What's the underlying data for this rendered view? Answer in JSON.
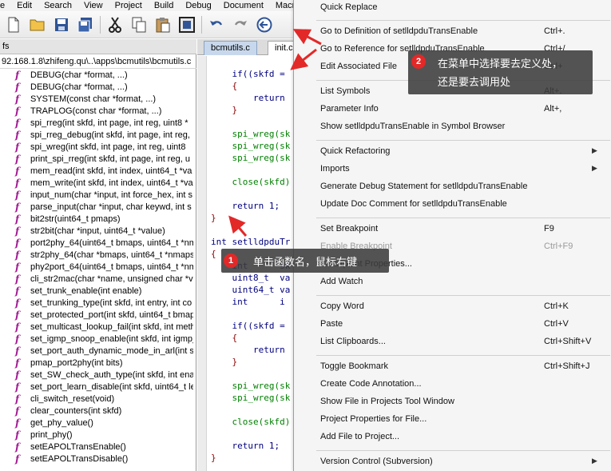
{
  "menubar": [
    "e",
    "Edit",
    "Search",
    "View",
    "Project",
    "Build",
    "Debug",
    "Document",
    "Macr"
  ],
  "toolbar_icons": [
    "new-file-icon",
    "open-folder-icon",
    "save-icon",
    "save-all-icon",
    "cut-icon",
    "copy-icon",
    "paste-icon",
    "frame-icon",
    "undo-icon",
    "redo-icon",
    "back-icon"
  ],
  "left_panel": {
    "tab": "fs",
    "path": "92.168.1.8\\zhifeng.qu\\..\\apps\\bcmutils\\bcmutils.c",
    "symbols": [
      "DEBUG(char *format, ...)",
      "DEBUG(char *format, ...)",
      "SYSTEM(const char *format, ...)",
      "TRAPLOG(const char *format, ...)",
      "spi_rreg(int skfd, int page, int reg, uint8 *",
      "spi_rreg_debug(int skfd, int page, int reg,",
      "spi_wreg(int skfd, int page, int reg, uint8",
      "print_spi_rreg(int skfd, int page, int reg, u",
      "mem_read(int skfd, int index, uint64_t *va",
      "mem_write(int skfd, int index, uint64_t *va",
      "input_num(char *input, int force_hex, int s",
      "parse_input(char *input, char keywd, int s",
      "bit2str(uint64_t pmaps)",
      "str2bit(char *input, uint64_t *value)",
      "port2phy_64(uint64_t bmaps, uint64_t *nm",
      "str2phy_64(char *bmaps, uint64_t *nmaps",
      "phy2port_64(uint64_t bmaps, uint64_t *nm",
      "cli_str2mac(char *name, unsigned char *va",
      "set_trunk_enable(int enable)",
      "set_trunking_type(int skfd, int entry, int co",
      "set_protected_port(int skfd, uint64_t bmap",
      "set_multicast_lookup_fail(int skfd, int meth",
      "set_igmp_snoop_enable(int skfd, int igmp_",
      "set_port_auth_dynamic_mode_in_arl(int sk",
      "pmap_port2phy(int bits)",
      "set_SW_check_auth_type(int skfd, int ena",
      "set_port_learn_disable(int skfd, uint64_t le",
      "cli_switch_reset(void)",
      "clear_counters(int skfd)",
      "get_phy_value()",
      "print_phy()",
      "setEAPOLTransEnable()",
      "setEAPOLTransDisable()"
    ]
  },
  "editor": {
    "tab_active": "bcmutils.c",
    "tab_other": "init.c",
    "code_lines": [
      "    if((skfd =",
      "    {",
      "        return",
      "    }",
      "",
      "    spi_wreg(sk",
      "    spi_wreg(sk",
      "    spi_wreg(sk",
      "",
      "    close(skfd)",
      "",
      "    return 1;",
      "}",
      "",
      "int setlldpduTr",
      "{",
      "    int      sk",
      "    uint8_t  va",
      "    uint64_t va",
      "    int      i",
      "",
      "    if((skfd =",
      "    {",
      "        return",
      "    }",
      "",
      "    spi_wreg(sk",
      "    spi_wreg(sk",
      "",
      "    close(skfd)",
      "",
      "    return 1;",
      "}"
    ]
  },
  "context_menu": [
    {
      "label": "Quick Replace",
      "shortcut": ""
    },
    {
      "label": "Go to Definition of setlldpduTransEnable",
      "shortcut": "Ctrl+."
    },
    {
      "label": "Go to Reference for setlldpduTransEnable",
      "shortcut": "Ctrl+/"
    },
    {
      "label": "Edit Associated File",
      "shortcut": "Ctrl+"
    },
    {
      "label": "List Symbols",
      "shortcut": "Alt+."
    },
    {
      "label": "Parameter Info",
      "shortcut": "Alt+,"
    },
    {
      "label": "Show setlldpduTransEnable in Symbol Browser",
      "shortcut": ""
    },
    {
      "label": "Quick Refactoring",
      "shortcut": "",
      "submenu": true
    },
    {
      "label": "Imports",
      "shortcut": "",
      "submenu": true
    },
    {
      "label": "Generate Debug Statement for setlldpduTransEnable",
      "shortcut": ""
    },
    {
      "label": "Update Doc Comment for setlldpduTransEnable",
      "shortcut": ""
    },
    {
      "label": "Set Breakpoint",
      "shortcut": "F9"
    },
    {
      "label": "Enable Breakpoint",
      "shortcut": "Ctrl+F9",
      "disabled": true
    },
    {
      "label": "Breakpoint Properties...",
      "shortcut": ""
    },
    {
      "label": "Add Watch",
      "shortcut": ""
    },
    {
      "label": "Copy Word",
      "shortcut": "Ctrl+K"
    },
    {
      "label": "Paste",
      "shortcut": "Ctrl+V"
    },
    {
      "label": "List Clipboards...",
      "shortcut": "Ctrl+Shift+V"
    },
    {
      "label": "Toggle Bookmark",
      "shortcut": "Ctrl+Shift+J"
    },
    {
      "label": "Create Code Annotation...",
      "shortcut": ""
    },
    {
      "label": "Show File in Projects Tool Window",
      "shortcut": ""
    },
    {
      "label": "Project Properties for File...",
      "shortcut": ""
    },
    {
      "label": "Add File to Project...",
      "shortcut": ""
    },
    {
      "label": "Version Control (Subversion)",
      "shortcut": "",
      "submenu": true
    }
  ],
  "annotations": {
    "step1_number": "1",
    "step1_text": "单击函数名，鼠标右键",
    "step2_number": "2",
    "step2_line1": "在菜单中选择要去定义处，",
    "step2_line2": "还是要去调用处"
  },
  "colors": {
    "annotation_arrow": "#e32828",
    "function_glyph": "#a31d94",
    "keyword": "#000080",
    "string_green": "#008000"
  }
}
